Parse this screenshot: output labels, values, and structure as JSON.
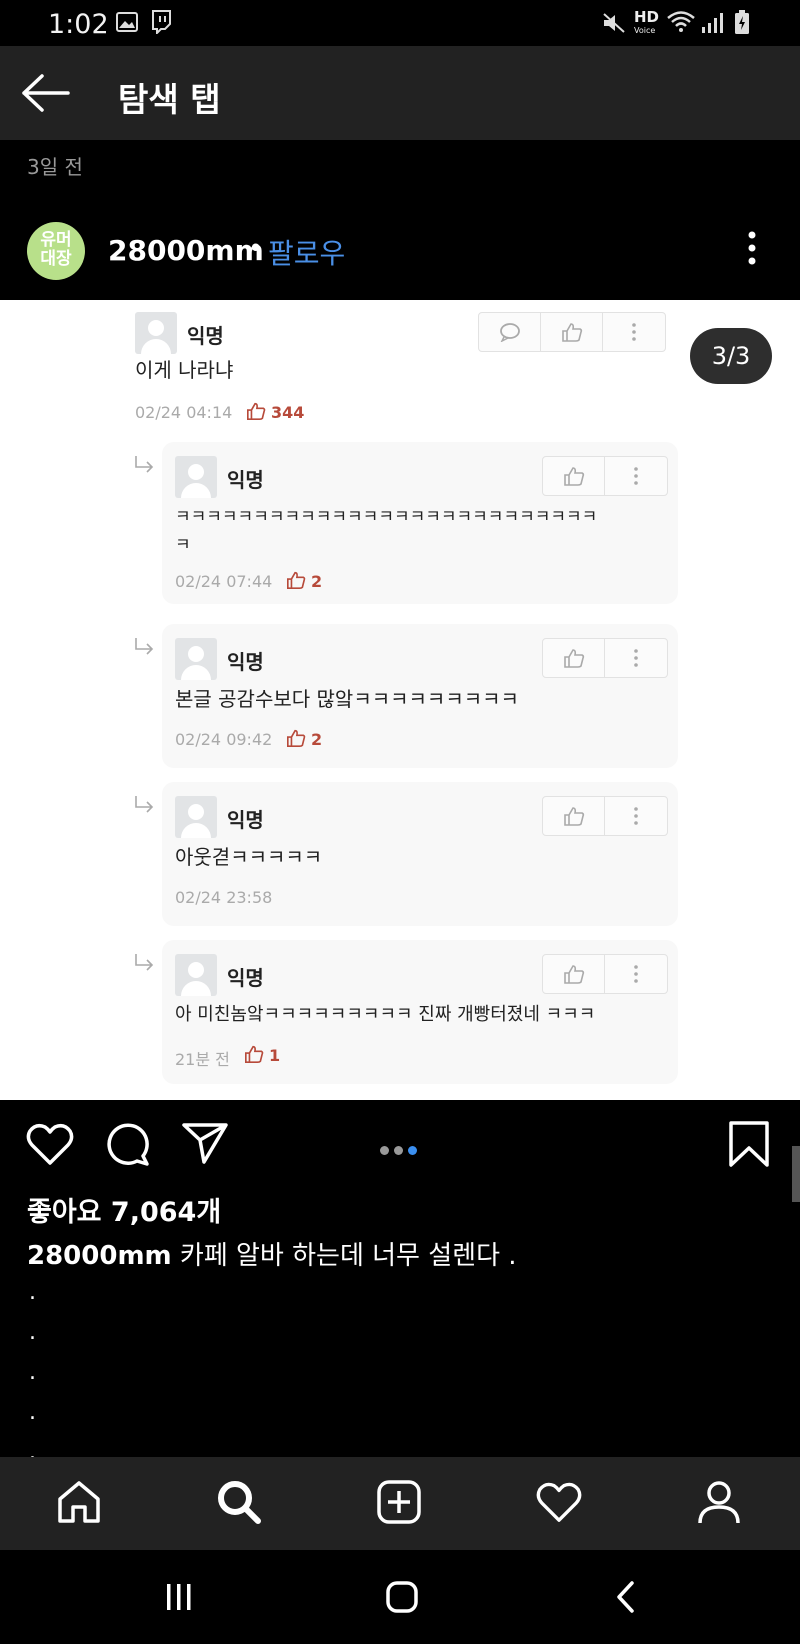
{
  "status": {
    "time": "1:02",
    "hd_label": "HD",
    "hd_sub": "Voice"
  },
  "header": {
    "title": "탐색 탭"
  },
  "post": {
    "time_ago": "3일 전",
    "avatar_text_1": "유머",
    "avatar_text_2": "대장",
    "username": "28000mm",
    "separator": "•",
    "follow_label": "팔로우"
  },
  "image": {
    "page_indicator": "3/3",
    "main_comment": {
      "name": "익명",
      "text": "이게 나라냐",
      "date": "02/24 04:14",
      "likes": "344"
    },
    "replies": [
      {
        "name": "익명",
        "text": "ㅋㅋㅋㅋㅋㅋㅋㅋㅋㅋㅋㅋㅋㅋㅋㅋㅋㅋㅋㅋㅋㅋㅋㅋㅋㅋㅋ",
        "text2": "ㅋ",
        "date": "02/24 07:44",
        "likes": "2"
      },
      {
        "name": "익명",
        "text": "본글 공감수보다 많앜ㅋㅋㅋㅋㅋㅋㅋㅋㅋ",
        "date": "02/24 09:42",
        "likes": "2"
      },
      {
        "name": "익명",
        "text": "아웃겯ㅋㅋㅋㅋㅋ",
        "date": "02/24 23:58",
        "likes": ""
      },
      {
        "name": "익명",
        "text": "아 미친놈앜ㅋㅋㅋㅋㅋㅋㅋㅋㅋ 진짜 개빵터졌네 ㅋㅋㅋ",
        "date": "21분 전",
        "likes": "1"
      }
    ]
  },
  "engagement": {
    "likes_text": "좋아요 7,064개",
    "caption_user": "28000mm",
    "caption_text": " 카페 알바 하는데 너무 설렌다 .",
    "caption_dots": [
      ".",
      ".",
      ".",
      ".",
      "."
    ]
  },
  "carousel": {
    "count": 3,
    "active_index": 2
  },
  "icons": {
    "back": "arrow-left-icon",
    "more": "more-vertical-icon",
    "like": "heart-icon",
    "comment": "comment-bubble-icon",
    "share": "send-icon",
    "save": "bookmark-icon",
    "home": "home-icon",
    "search": "search-icon",
    "add": "add-post-icon",
    "activity": "heart-icon",
    "profile": "profile-icon"
  },
  "colors": {
    "follow": "#4a8fe6",
    "likes_count": "#b74a3a",
    "carousel_active": "#3b8ff0"
  }
}
